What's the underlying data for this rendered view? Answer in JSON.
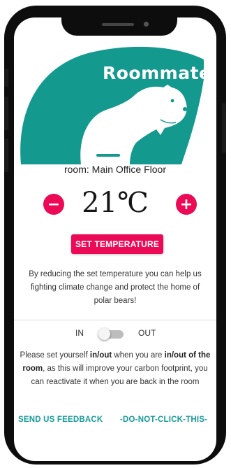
{
  "app": {
    "brand": "Roommate"
  },
  "room": {
    "label": "room: Main Office Floor"
  },
  "temperature": {
    "value": "21℃",
    "decrease_icon": "minus-icon",
    "increase_icon": "plus-icon",
    "set_label": "SET TEMPERATURE"
  },
  "info": {
    "text": "By reducing the set temperature you can help us fighting climate change and protect the home of polar bears!"
  },
  "presence": {
    "in_label": "IN",
    "out_label": "OUT",
    "checked": false,
    "notice": {
      "part1": "Please set yourself ",
      "bold1": "in/out",
      "part2": " when you are ",
      "bold2": "in/out of the room",
      "part3": ", as this will improve your carbon footprint, you can reactivate it when you are back in the room"
    }
  },
  "links": {
    "feedback": "SEND US FEEDBACK",
    "dont_click": "-DO-NOT-CLICK-THIS-"
  },
  "colors": {
    "teal": "#14998f",
    "accent": "#ec0a56",
    "link": "#159b9a"
  }
}
